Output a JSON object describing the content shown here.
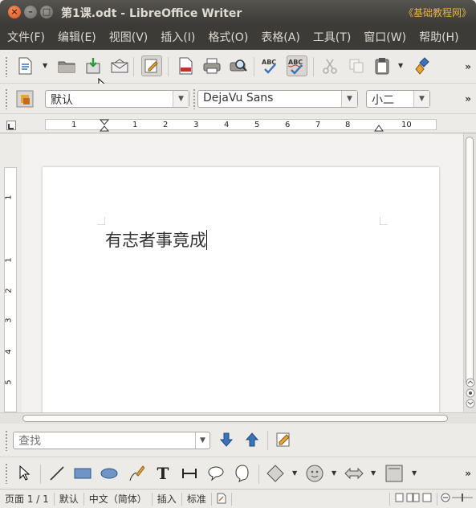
{
  "window": {
    "title": "第1课.odt - LibreOffice Writer",
    "watermark": "《基础教程网》",
    "close_glyph": "×",
    "min_glyph": "–",
    "max_glyph": "□"
  },
  "menubar": {
    "items": [
      "文件(F)",
      "编辑(E)",
      "视图(V)",
      "插入(I)",
      "格式(O)",
      "表格(A)",
      "工具(T)",
      "窗口(W)",
      "帮助(H)"
    ]
  },
  "toolbar_standard": {
    "buttons": [
      "new-document-icon",
      "open-folder-icon",
      "save-icon",
      "email-icon",
      "edit-mode-icon",
      "export-pdf-icon",
      "print-icon",
      "print-preview-icon",
      "spellcheck-icon",
      "autospellcheck-icon",
      "cut-icon",
      "copy-icon",
      "paste-icon",
      "format-paintbrush-icon"
    ],
    "overflow": "»"
  },
  "toolbar_formatting": {
    "paragraph_style": "默认",
    "font_name": "DejaVu Sans",
    "font_size": "小二",
    "overflow": "»"
  },
  "ruler": {
    "h_numbers": [
      "1",
      "1",
      "2",
      "3",
      "4",
      "5",
      "6",
      "7",
      "8",
      "10"
    ],
    "v_numbers": [
      "1",
      "1",
      "2",
      "3",
      "4",
      "5"
    ]
  },
  "document": {
    "text": "有志者事竟成"
  },
  "findbar": {
    "placeholder": "查找"
  },
  "drawbar": {
    "text_tool_glyph": "T"
  },
  "statusbar": {
    "page": "页面 1 / 1",
    "style": "默认",
    "language": "中文（简体）",
    "insert_mode": "插入",
    "selection_mode": "标准"
  },
  "colors": {
    "titlebar": "#3c3b37",
    "menu_text": "#dfdbd2",
    "watermark": "#e8b349",
    "close_button": "#e0531d"
  }
}
